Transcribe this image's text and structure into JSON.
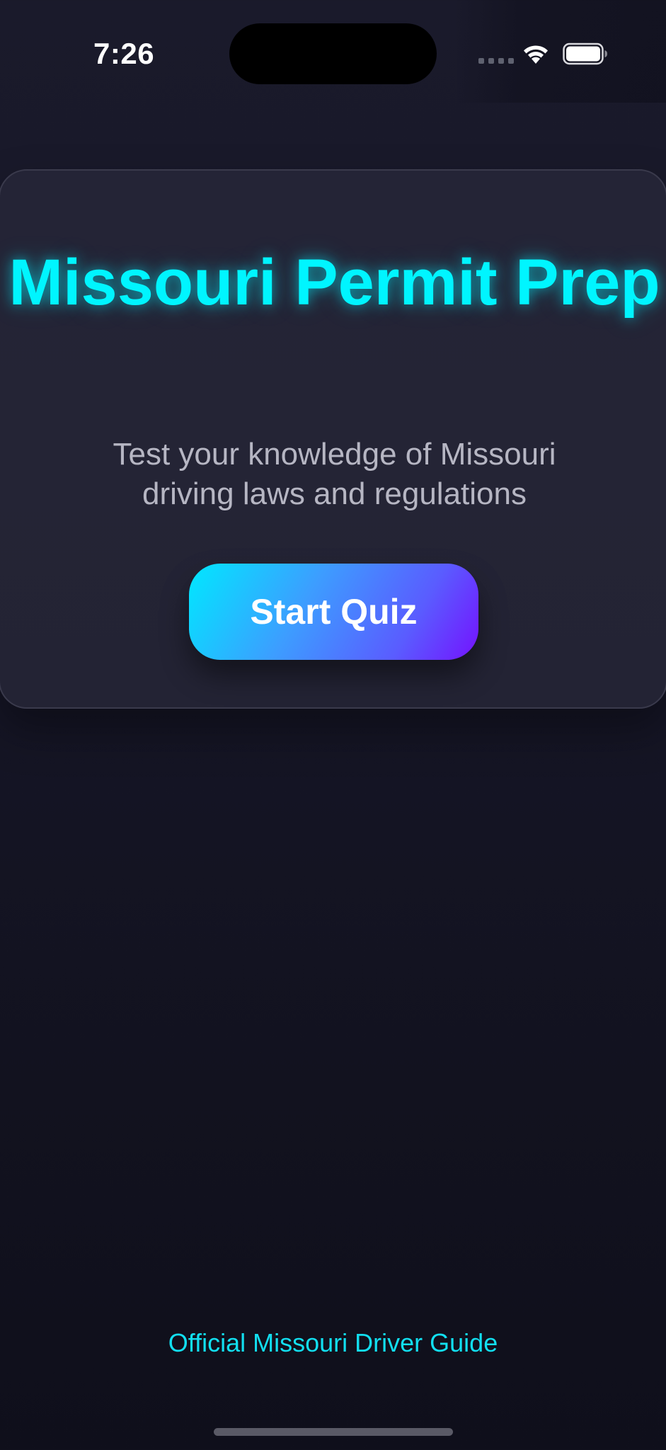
{
  "status_bar": {
    "time": "7:26"
  },
  "card": {
    "title": "Missouri Permit Prep",
    "subtitle": "Test your knowledge of Missouri driving laws and regulations",
    "start_button_label": "Start Quiz"
  },
  "footer": {
    "link_text": "Official Missouri Driver Guide"
  },
  "icons": {
    "wifi": "wifi-icon",
    "battery": "battery-icon",
    "signal": "cellular-signal-icon"
  },
  "colors": {
    "accent": "#00f5ff",
    "button_gradient_start": "#00e8ff",
    "button_gradient_end": "#7412ff",
    "link": "#12dff0",
    "background": "#161627"
  }
}
